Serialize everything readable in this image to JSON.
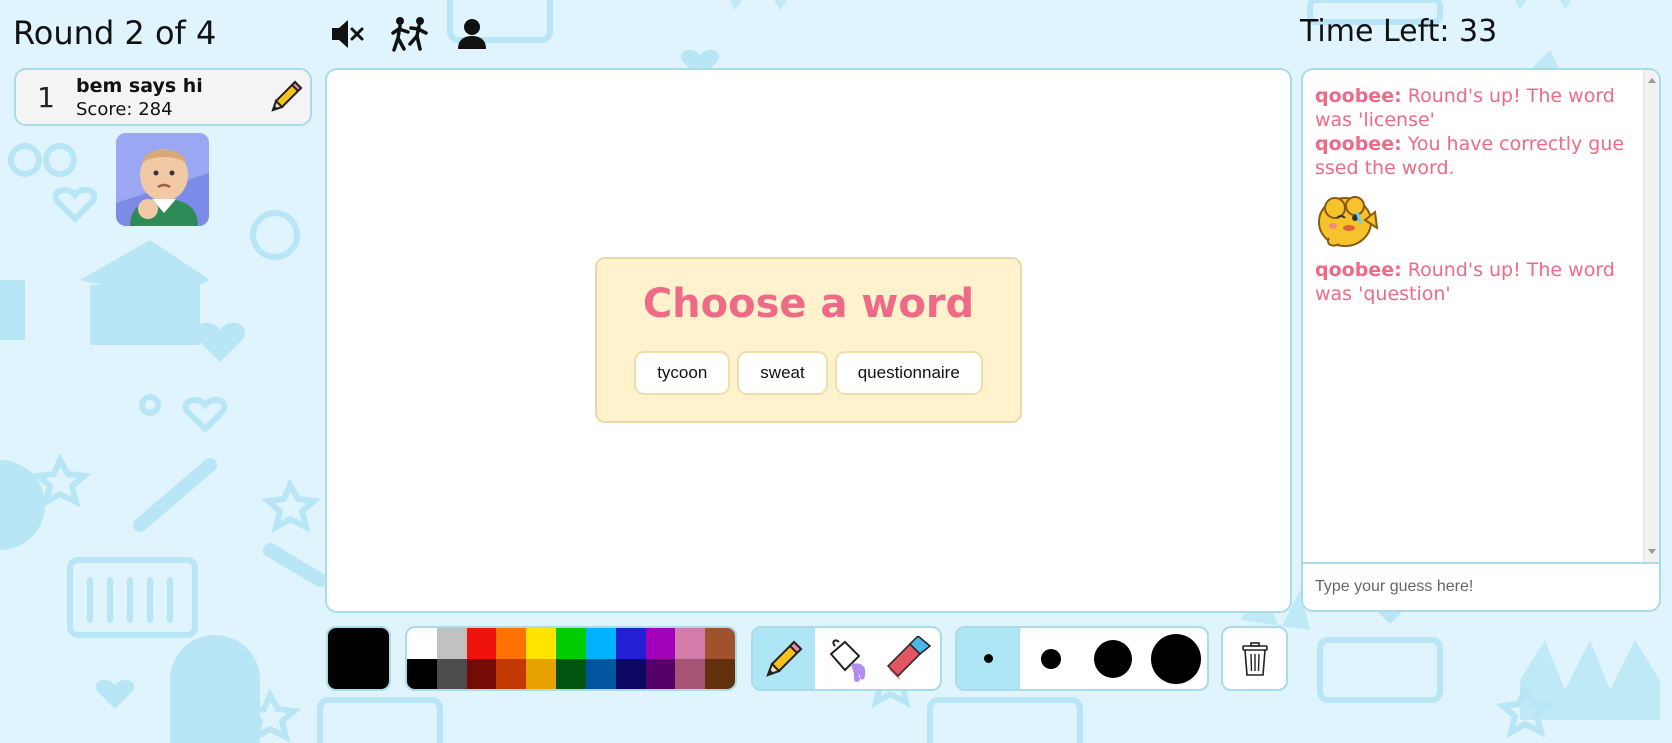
{
  "header": {
    "round_label": "Round 2 of 4",
    "timer_label": "Time Left: 33",
    "icons": [
      "mute-icon",
      "kick-icon",
      "profile-icon"
    ]
  },
  "players": [
    {
      "rank": "1",
      "name": "bem says hi",
      "score": "Score: 284",
      "is_drawing": true
    }
  ],
  "word_choice": {
    "title": "Choose a word",
    "options": [
      "tycoon",
      "sweat",
      "questionnaire"
    ]
  },
  "chat": {
    "messages": [
      {
        "user": "qoobee:",
        "text": "Round's up! The word was 'license'"
      },
      {
        "user": "qoobee:",
        "text": "You have correctly guessed the word."
      },
      {
        "user": "qoobee:",
        "text": "Round's up! The word was 'question'"
      }
    ],
    "input_placeholder": "Type your guess here!"
  },
  "toolbar": {
    "current_color": "#000000",
    "palette_top": [
      "#ffffff",
      "#c1c1c1",
      "#ef130b",
      "#ff7100",
      "#ffe400",
      "#00cc00",
      "#00b2ff",
      "#231fd3",
      "#a300ba",
      "#d37caa",
      "#a0522d"
    ],
    "palette_bottom": [
      "#000000",
      "#4c4c4c",
      "#740b07",
      "#c23800",
      "#e8a200",
      "#005510",
      "#00569e",
      "#0e0865",
      "#550069",
      "#a75574",
      "#63300d"
    ],
    "tools": [
      "pencil-icon",
      "fill-bucket-icon",
      "eraser-icon"
    ],
    "active_tool": "pencil",
    "brush_sizes": [
      "small",
      "medium",
      "large",
      "x-large"
    ],
    "active_size": "small"
  },
  "theme": {
    "accent": "#ee6a86",
    "border": "#a9dbe8",
    "background": "#dff4fc",
    "panel": "#fff2cc"
  }
}
